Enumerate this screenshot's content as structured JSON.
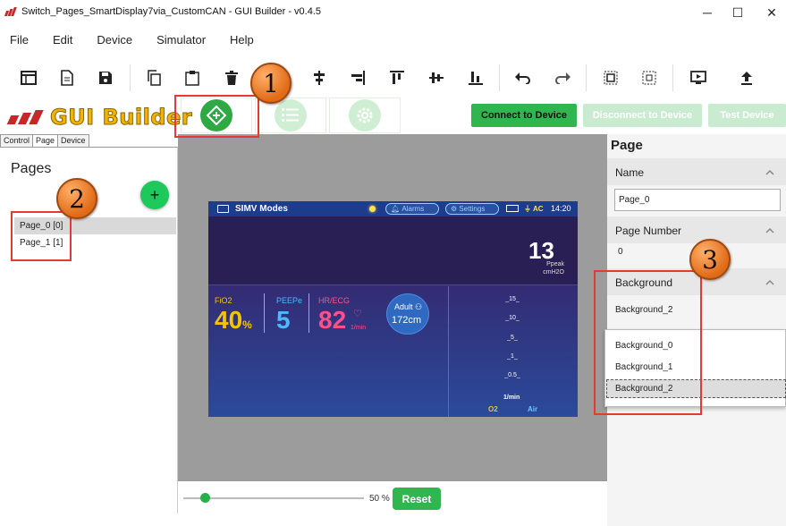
{
  "window": {
    "title": "Switch_Pages_SmartDisplay7via_CustomCAN - GUI Builder - v0.4.5",
    "minimize_label": "─",
    "maximize_label": "☐",
    "close_label": "✕"
  },
  "menu": {
    "items": [
      "File",
      "Edit",
      "Device",
      "Simulator",
      "Help"
    ]
  },
  "toolbar": {
    "icons": [
      "new-page-icon",
      "document-icon",
      "save-icon",
      "copy-icon",
      "paste-icon",
      "delete-icon",
      "align-left-icon",
      "align-center-icon",
      "align-right-icon",
      "align-top-icon",
      "align-middle-icon",
      "align-bottom-icon",
      "undo-icon",
      "redo-icon",
      "group-icon",
      "ungroup-icon",
      "preview-icon",
      "upload-icon"
    ]
  },
  "header": {
    "logo_text": "GUI Builder",
    "modes": [
      "design-mode-icon",
      "list-mode-icon",
      "settings-mode-icon"
    ],
    "connect_label": "Connect to Device",
    "disconnect_label": "Disconnect to Device",
    "test_label": "Test Device",
    "colors": {
      "accent_green": "#2fb64e",
      "disabled_green": "#bfe8c5"
    }
  },
  "left_panel": {
    "tabs": [
      "Control",
      "Page",
      "Device"
    ],
    "active_tab": "Page",
    "title": "Pages",
    "add_label": "+",
    "pages": [
      "Page_0 [0]",
      "Page_1 [1]"
    ],
    "selected_page": "Page_0 [0]"
  },
  "canvas": {
    "zoom_label": "50 %",
    "zoom_percent": 50,
    "reset_label": "Reset",
    "device": {
      "mode_title": "SIMV Modes",
      "alarms_label": "Alarms",
      "settings_label": "Settings",
      "ac_label": "AC",
      "time": "14:20",
      "ppeak_value": "13",
      "ppeak_label": "Ppeak",
      "ppeak_unit": "cmH2O",
      "fio2_label": "FiO2",
      "fio2_value": "40",
      "fio2_unit": "%",
      "peep_label": "PEEPe",
      "peep_value": "5",
      "hr_label": "HR/ECG",
      "hr_value": "82",
      "hr_unit": "1/min",
      "adult_label": "Adult",
      "adult_height": "172cm",
      "scale": [
        "_15_",
        "_10_",
        "_5_",
        "_1_",
        "_0.5_"
      ],
      "scale_unit": "1/min",
      "o2_label": "O2",
      "air_label": "Air",
      "colors": {
        "fio2": "#f4c20d",
        "peep": "#4fb6ff",
        "hr": "#ff4f8a"
      }
    }
  },
  "right_panel": {
    "title": "Page",
    "name_section": "Name",
    "name_value": "Page_0",
    "number_section": "Page Number",
    "number_value": "0",
    "background_section": "Background",
    "background_value": "Background_2",
    "background_options": [
      "Background_0",
      "Background_1",
      "Background_2"
    ],
    "selected_background": "Background_2"
  },
  "annotations": {
    "labels": [
      "1",
      "2",
      "3"
    ],
    "color": "#e53935"
  }
}
